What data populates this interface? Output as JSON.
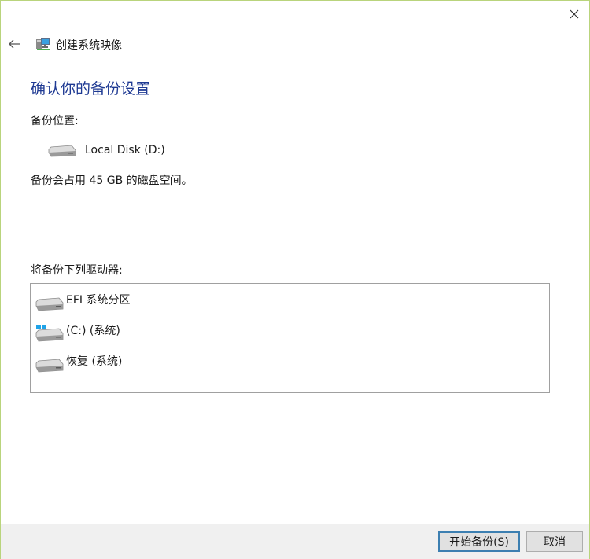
{
  "window": {
    "title": "创建系统映像",
    "close_icon": "close-icon",
    "back_icon": "back-arrow-icon"
  },
  "main": {
    "heading": "确认你的备份设置",
    "backup_location_label": "备份位置:",
    "backup_location": {
      "name": "Local Disk (D:)",
      "icon": "hard-disk-icon"
    },
    "space_note": "备份会占用 45 GB 的磁盘空间。",
    "drives_label": "将备份下列驱动器:",
    "drives": [
      {
        "label": "EFI 系统分区",
        "icon": "hard-disk-icon"
      },
      {
        "label": "(C:) (系统)",
        "icon": "windows-disk-icon"
      },
      {
        "label": "恢复 (系统)",
        "icon": "hard-disk-icon"
      }
    ]
  },
  "footer": {
    "start_label": "开始备份(S)",
    "cancel_label": "取消"
  },
  "colors": {
    "heading": "#1f3a93",
    "window_border": "#b9d47c",
    "footer_bg": "#f0f0f0",
    "default_button_border": "#3c7fb1",
    "windows_logo": "#1fa3e8"
  }
}
